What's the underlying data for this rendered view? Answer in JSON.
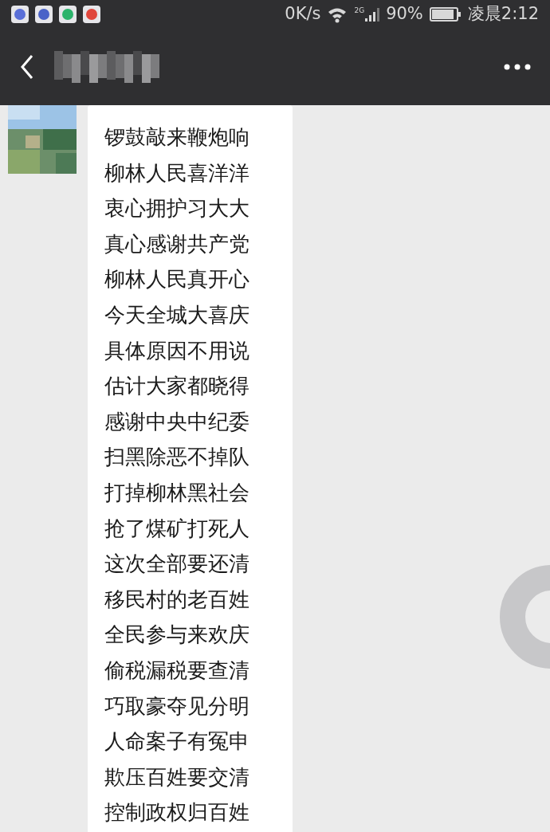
{
  "status_bar": {
    "app_icons": [
      {
        "color": "#5a6fd8"
      },
      {
        "color": "#4a63c8"
      },
      {
        "color": "#2bb36b"
      },
      {
        "color": "#e0463c"
      }
    ],
    "net_speed": "0K/s",
    "network": "2G",
    "battery": "90%",
    "time": "凌晨2:12"
  },
  "messages": [
    {
      "kind": "incoming",
      "lines": [
        "锣鼓敲来鞭炮响",
        "柳林人民喜洋洋",
        "衷心拥护习大大",
        "真心感谢共产党",
        "柳林人民真开心",
        "今天全城大喜庆",
        "具体原因不用说",
        "估计大家都晓得",
        "感谢中央中纪委",
        "扫黑除恶不掉队",
        "打掉柳林黑社会",
        "抢了煤矿打死人",
        "这次全部要还清",
        "移民村的老百姓",
        "全民参与来欢庆",
        "偷税漏税要查清",
        "巧取豪夺见分明",
        "人命案子有冤申",
        "欺压百姓要交清",
        "控制政权归百姓"
      ]
    }
  ]
}
